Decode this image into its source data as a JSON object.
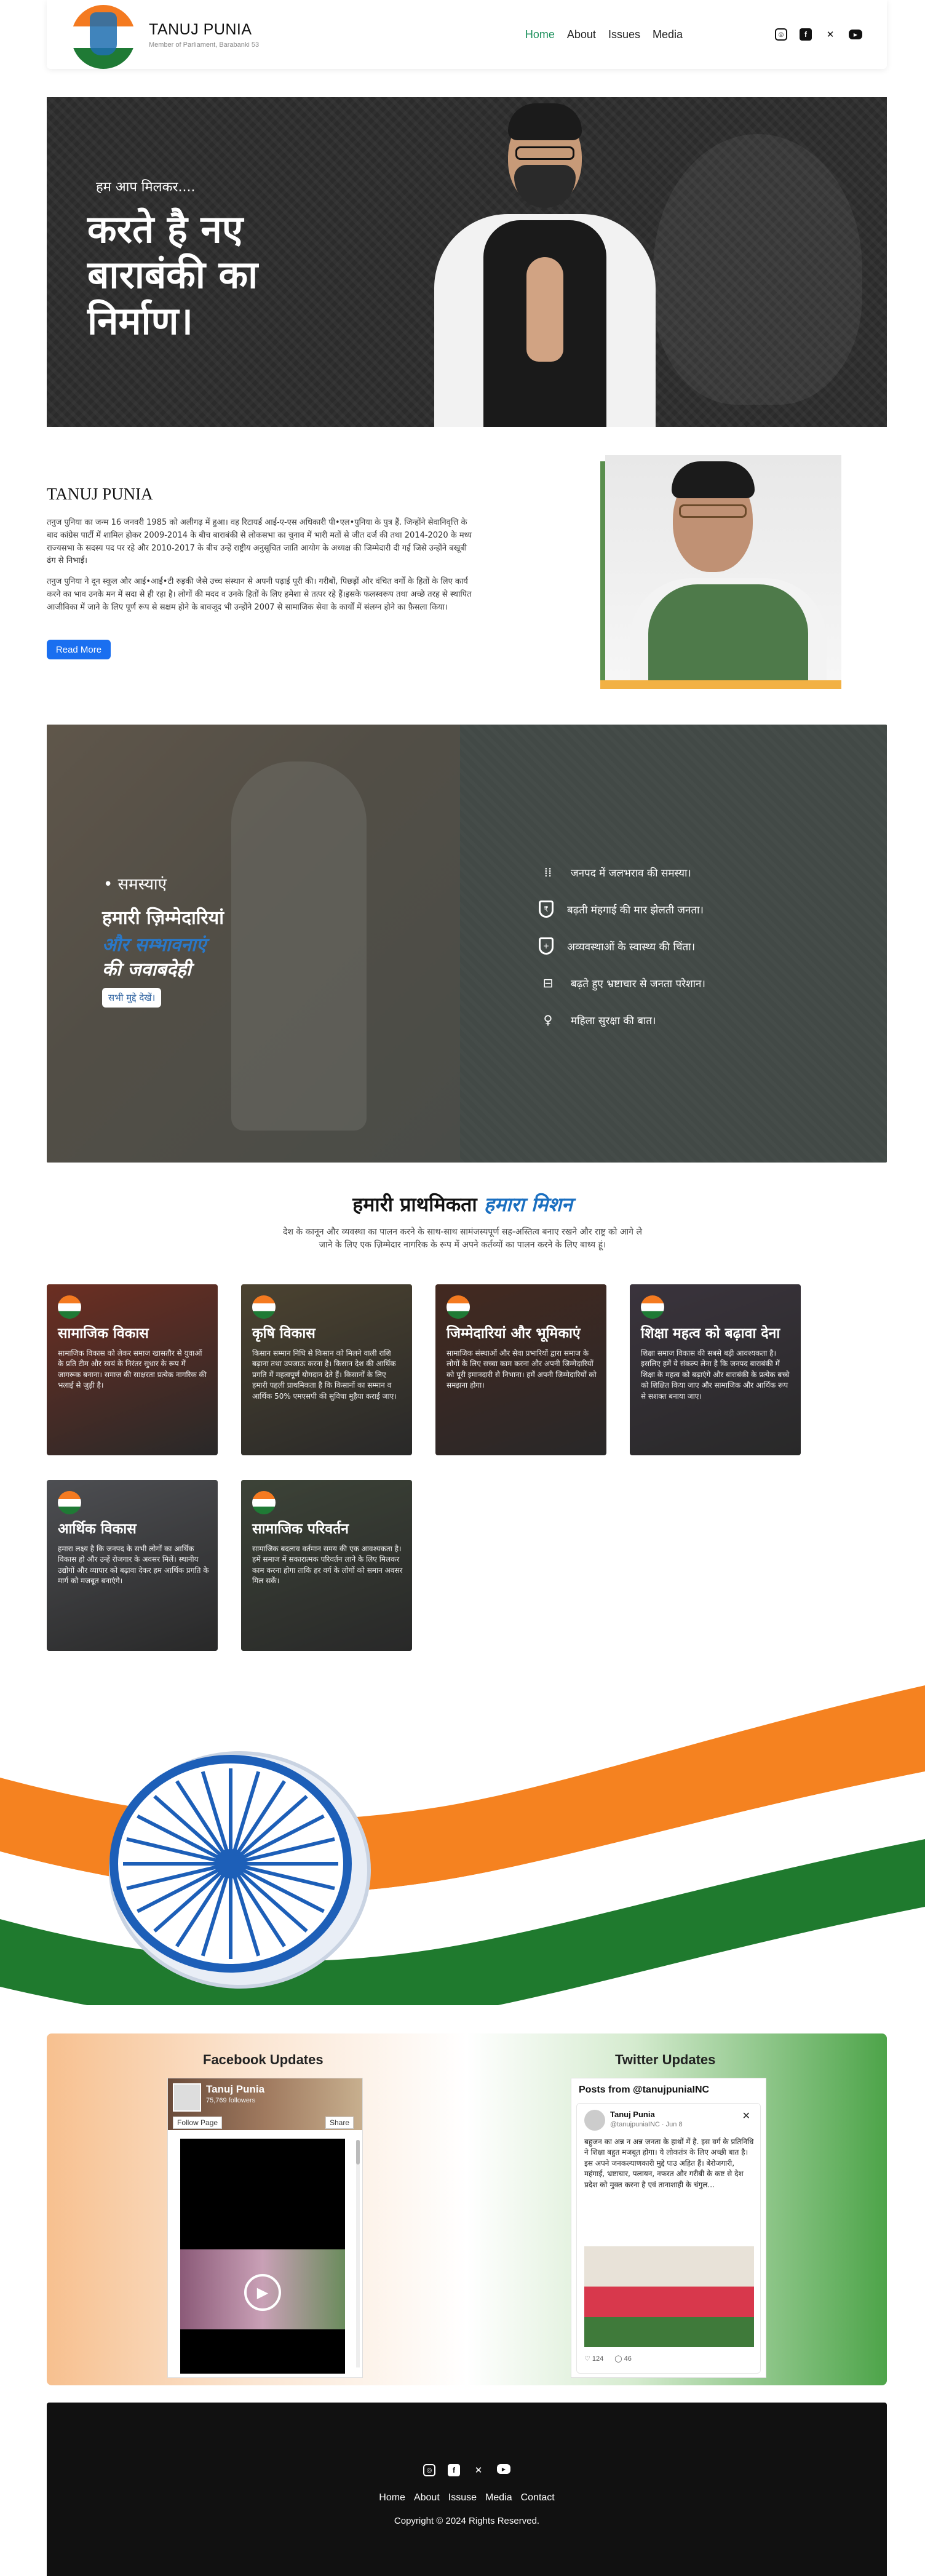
{
  "header": {
    "name": "TANUJ PUNIA",
    "subtitle": "Member of Parliament, Barabanki 53",
    "nav": [
      "Home",
      "About",
      "Issues",
      "Media"
    ],
    "active_nav": "Home"
  },
  "social_icons": [
    "instagram-icon",
    "facebook-icon",
    "x-icon",
    "youtube-icon"
  ],
  "hero": {
    "small": "हम आप मिलकर....",
    "big": "करते है नए बाराबंकी का निर्माण।"
  },
  "about": {
    "title": "TANUJ PUNIA",
    "p1": "तनुज पुनिया का जन्म 16 जनवरी 1985 को अलीगढ़ में हुआ। वह रिटायर्ड आई-ए-एस अधिकारी पी•एल•पुनिया के पुत्र हैं. जिन्होंने सेवानिवृत्ति के बाद कांग्रेस पार्टी में शामिल होकर 2009-2014 के बीच बाराबंकी से लोकसभा का चुनाव में भारी मतों से जीत दर्ज की तथा 2014-2020 के मध्य राज्यसभा के सदस्य पद पर रहे और 2010-2017 के बीच उन्हें राष्ट्रीय अनुसूचित जाति आयोग के अध्यक्ष की जिम्मेदारी दी गई जिसे उन्होंने बखूबी ढंग से निभाई।",
    "p2": "तनुज पुनिया ने दून स्कूल और आई•आई•टी रुड़की जैसे उच्च संस्थान से अपनी पढ़ाई पूरी की। गरीबों, पिछड़ों और वंचित वर्गों के हितों के लिए कार्य करने का भाव उनके मन में सदा से ही रहा है। लोगों की मदद व उनके हितों के लिए हमेशा से तत्पर रहे हैं।इसके फलस्वरूप तथा अच्छे तरह से स्थापित आजीविका में जाने के लिए पूर्ण रूप से सक्षम होने के बावजूद भी उन्होंने 2007 से सामाजिक सेवा के कार्यों में संलग्न होने का फ़ैसला किया।",
    "button": "Read More"
  },
  "issues": {
    "bullet": "समस्याएं",
    "line1": "हमारी ज़िम्मेदारियां",
    "line2": "और सम्भावनाएं",
    "line3": "की जवाबदेही",
    "button": "सभी मुद्दे देखें।",
    "items": [
      {
        "icon": "water-icon",
        "glyph": "⁞⁞",
        "text": "जनपद में जलभराव की समस्या।"
      },
      {
        "icon": "rupee-shield-icon",
        "glyph": "₹",
        "text": "बढ़ती मंहगाई की मार झेलती जनता।"
      },
      {
        "icon": "health-shield-icon",
        "glyph": "+",
        "text": "अव्यवस्थाओं के स्वास्थ्य की चिंता।"
      },
      {
        "icon": "corruption-icon",
        "glyph": "⊟",
        "text": "बढ़ते हुए भ्रष्टाचार से जनता परेशान।"
      },
      {
        "icon": "women-safety-icon",
        "glyph": "♀",
        "text": "महिला सुरक्षा की बात।"
      }
    ]
  },
  "mission": {
    "title_plain": "हमारी प्राथमिकता ",
    "title_highlight": "हमारा मिशन",
    "description": "देश के कानून और व्यवस्था का पालन करने के साथ-साथ सामंजस्यपूर्ण सह-अस्तित्व बनाए रखने और राष्ट्र को आगे ले जाने के लिए एक ज़िम्मेदार नागरिक के रूप में अपने कर्तव्यों का पालन करने के लिए बाध्य हूं।"
  },
  "cards": [
    {
      "title": "सामाजिक विकास",
      "text": "सामाजिक विकास को लेकर समाज खासतौर से युवाओं के प्रति टीम और स्वयं के निरंतर सुधार के रूप में जागरूक बनाना। समाज की साक्षरता प्रत्येक नागरिक की भलाई से जुड़ी है।",
      "color": "#b5452f"
    },
    {
      "title": "कृषि विकास",
      "text": "किसान सम्मान निधि से किसान को मिलने वाली राशि बढ़ाना तथा उपजाऊ करना है। किसान देश की आर्थिक प्रगति में महत्वपूर्ण योगदान देते हैं। किसानों के लिए हमारी पहली प्राथमिकता है कि किसानों का सम्मान व आर्थिक 50% एमएसपी की सुविधा मुहैया कराई जाए।",
      "color": "#7a6a48"
    },
    {
      "title": "जिम्मेदारियां और भूमिकाएं",
      "text": "सामाजिक संस्थाओं और सेवा प्रभारियों द्वारा समाज के लोगों के लिए सच्चा काम करना और अपनी जिम्मेदारियों को पूरी इमानदारी से निभाना। हमें अपनी जिम्मेदारियों को समझना होगा।",
      "color": "#6b3b2b"
    },
    {
      "title": "शिक्षा महत्व को बढ़ावा देना",
      "text": "शिक्षा समाज विकास की सबसे बड़ी आवश्यकता है। इसलिए हमें ये संकल्प लेना है कि जनपद बाराबंकी में शिक्षा के महत्व को बढ़ाएंगे और बाराबंकी के प्रत्येक बच्चे को शिक्षित किया जाए और सामाजिक और आर्थिक रूप से सशक्त बनाया जाए।",
      "color": "#5a4e5e"
    },
    {
      "title": "आर्थिक विकास",
      "text": "हमारा लक्ष्य है कि जनपद के सभी लोगों का आर्थिक विकास हो और उन्हें रोजगार के अवसर मिलें। स्थानीय उद्योगों और व्यापार को बढ़ावा देकर हम आर्थिक प्रगति के मार्ग को मजबूत बनाएंगे।",
      "color": "#7d7f86"
    },
    {
      "title": "सामाजिक परिवर्तन",
      "text": "सामाजिक बदलाव वर्तमान समय की एक आवश्यकता है। हमें समाज में सकारात्मक परिवर्तन लाने के लिए मिलकर काम करना होगा ताकि हर वर्ग के लोगों को समान अवसर मिल सकें।",
      "color": "#5e6a55"
    }
  ],
  "feeds": {
    "facebook_title": "Facebook Updates",
    "fb_page_name": "Tanuj Punia",
    "fb_followers": "75,769 followers",
    "fb_follow": "Follow Page",
    "fb_share": "Share",
    "twitter_title": "Twitter Updates",
    "tw_header": "Posts from @tanujpuniaINC",
    "tw_name": "Tanuj Punia",
    "tw_handle": "@tanujpuniaINC · Jun 8",
    "tw_text": "बहुजन का अन्न न अन्न जनता के हाथों में है. इस वर्ग के प्रतिनिधि ने शिक्षा बहुत मजबूत होगा। ये लोकतंत्र के लिए अच्छी बात है। इस अपने जनकल्याणकारी मुद्दे पाउ अहित हैं। बेरोजगारी, महंगाई, भ्रष्टाचार, पलायन, नफरत और गरीबी के कष्ट से देश प्रदेश को मुक्त करना है एवं तानाशाही के चंगुल...",
    "tw_likes": "124",
    "tw_replies": "46"
  },
  "footer": {
    "links": [
      "Home",
      "About",
      "Issuse",
      "Media",
      "Contact"
    ],
    "copyright": "Copyright © 2024 Rights Reserved."
  }
}
